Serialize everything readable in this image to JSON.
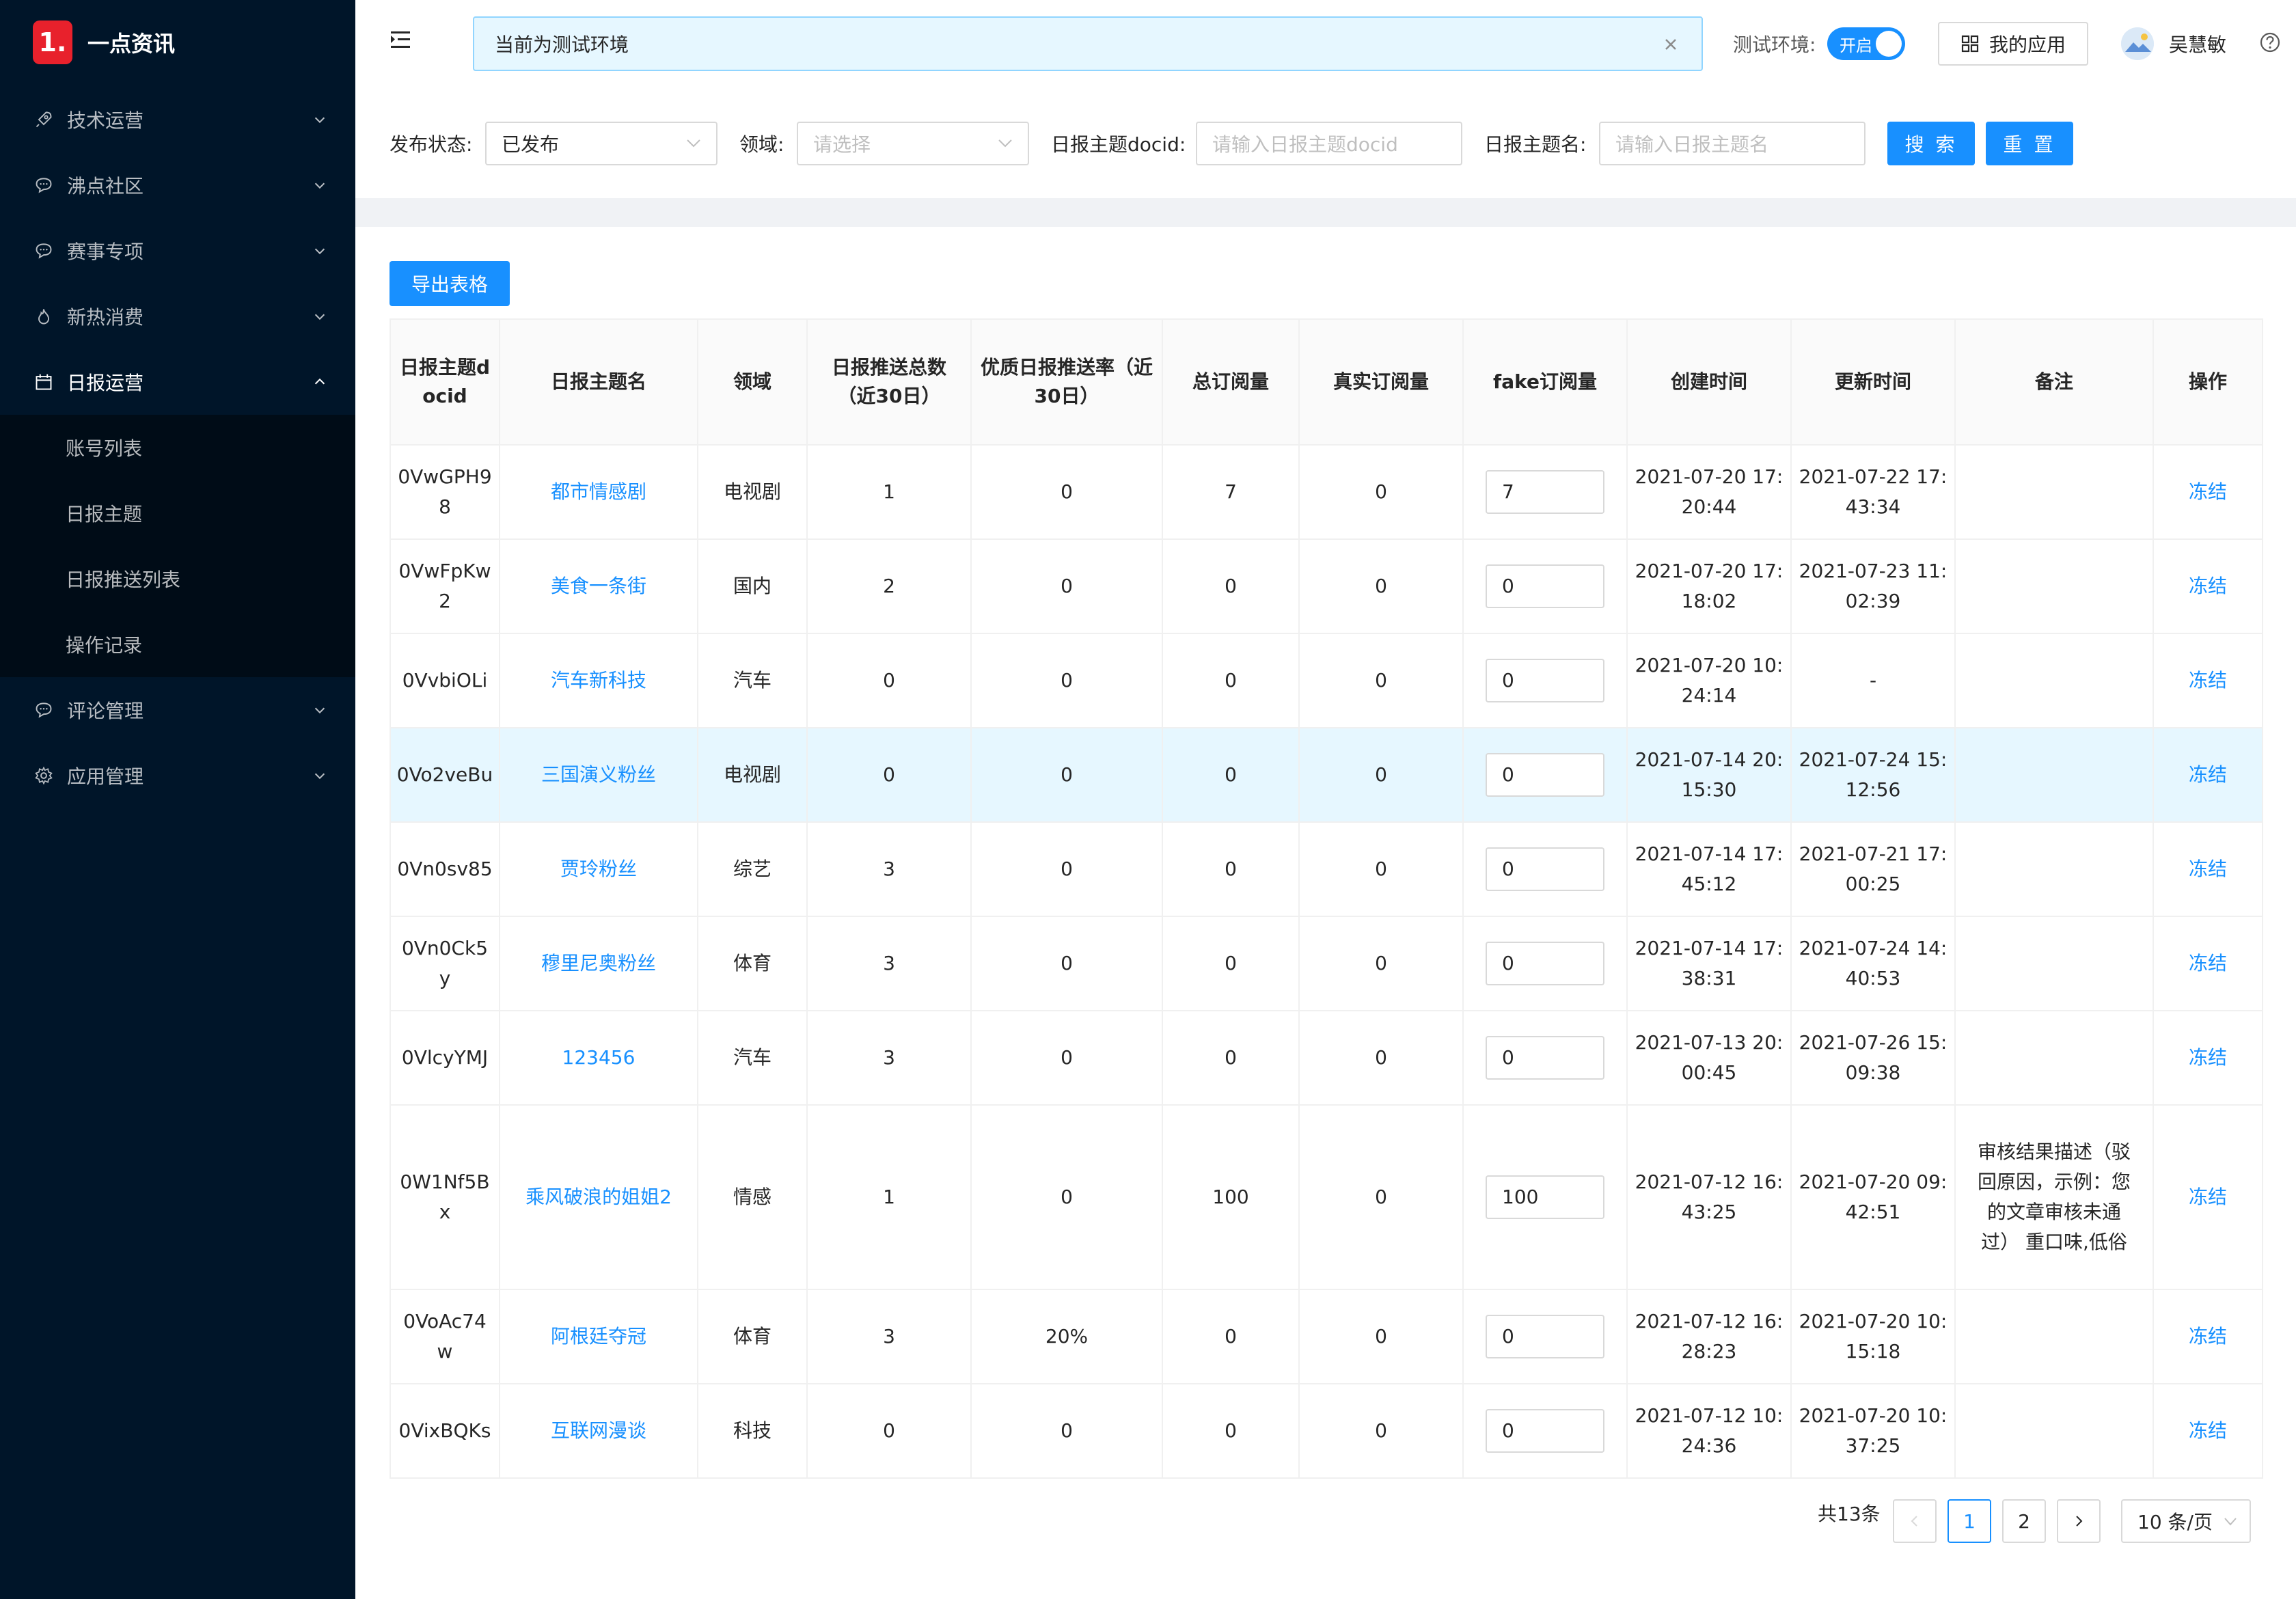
{
  "app": {
    "logo_mark": "1.",
    "title": "一点资讯"
  },
  "sidebar": {
    "items": [
      {
        "label": "技术运营",
        "icon": "rocket-icon"
      },
      {
        "label": "沸点社区",
        "icon": "comment-icon"
      },
      {
        "label": "赛事专项",
        "icon": "comment-icon"
      },
      {
        "label": "新热消费",
        "icon": "fire-icon"
      },
      {
        "label": "日报运营",
        "icon": "calendar-icon",
        "open": true,
        "children": [
          {
            "label": "账号列表"
          },
          {
            "label": "日报主题"
          },
          {
            "label": "日报推送列表"
          },
          {
            "label": "操作记录"
          }
        ]
      },
      {
        "label": "评论管理",
        "icon": "comment-icon"
      },
      {
        "label": "应用管理",
        "icon": "gear-icon"
      }
    ]
  },
  "header": {
    "alert_text": "当前为测试环境",
    "env_label": "测试环境:",
    "env_switch_text": "开启",
    "myapp_label": "我的应用",
    "username": "吴慧敏"
  },
  "filters": {
    "status_label": "发布状态:",
    "status_value": "已发布",
    "domain_label": "领域:",
    "domain_placeholder": "请选择",
    "docid_label": "日报主题docid:",
    "docid_placeholder": "请输入日报主题docid",
    "name_label": "日报主题名:",
    "name_placeholder": "请输入日报主题名",
    "search_btn": "搜 索",
    "reset_btn": "重 置"
  },
  "toolbar": {
    "export_btn": "导出表格"
  },
  "table": {
    "headers": [
      "日报主题docid",
      "日报主题名",
      "领域",
      "日报推送总数（近30日）",
      "优质日报推送率（近30日）",
      "总订阅量",
      "真实订阅量",
      "fake订阅量",
      "创建时间",
      "更新时间",
      "备注",
      "操作"
    ],
    "rows": [
      {
        "docid": "0VwGPH98",
        "name": "都市情感剧",
        "domain": "电视剧",
        "push_total": "1",
        "quality_rate": "0",
        "total_sub": "7",
        "real_sub": "0",
        "fake_sub": "7",
        "created": "2021-07-20 17:20:44",
        "updated": "2021-07-22 17:43:34",
        "note": "",
        "action": "冻结"
      },
      {
        "docid": "0VwFpKw2",
        "name": "美食一条街",
        "domain": "国内",
        "push_total": "2",
        "quality_rate": "0",
        "total_sub": "0",
        "real_sub": "0",
        "fake_sub": "0",
        "created": "2021-07-20 17:18:02",
        "updated": "2021-07-23 11:02:39",
        "note": "",
        "action": "冻结"
      },
      {
        "docid": "0VvbiOLi",
        "name": "汽车新科技",
        "domain": "汽车",
        "push_total": "0",
        "quality_rate": "0",
        "total_sub": "0",
        "real_sub": "0",
        "fake_sub": "0",
        "created": "2021-07-20 10:24:14",
        "updated": "-",
        "note": "",
        "action": "冻结"
      },
      {
        "docid": "0Vo2veBu",
        "name": "三国演义粉丝",
        "domain": "电视剧",
        "push_total": "0",
        "quality_rate": "0",
        "total_sub": "0",
        "real_sub": "0",
        "fake_sub": "0",
        "created": "2021-07-14 20:15:30",
        "updated": "2021-07-24 15:12:56",
        "note": "",
        "action": "冻结",
        "highlight": true
      },
      {
        "docid": "0Vn0sv85",
        "name": "贾玲粉丝",
        "domain": "综艺",
        "push_total": "3",
        "quality_rate": "0",
        "total_sub": "0",
        "real_sub": "0",
        "fake_sub": "0",
        "created": "2021-07-14 17:45:12",
        "updated": "2021-07-21 17:00:25",
        "note": "",
        "action": "冻结"
      },
      {
        "docid": "0Vn0Ck5y",
        "name": "穆里尼奥粉丝",
        "domain": "体育",
        "push_total": "3",
        "quality_rate": "0",
        "total_sub": "0",
        "real_sub": "0",
        "fake_sub": "0",
        "created": "2021-07-14 17:38:31",
        "updated": "2021-07-24 14:40:53",
        "note": "",
        "action": "冻结"
      },
      {
        "docid": "0VlcyYMJ",
        "name": "123456",
        "domain": "汽车",
        "push_total": "3",
        "quality_rate": "0",
        "total_sub": "0",
        "real_sub": "0",
        "fake_sub": "0",
        "created": "2021-07-13 20:00:45",
        "updated": "2021-07-26 15:09:38",
        "note": "",
        "action": "冻结"
      },
      {
        "docid": "0W1Nf5Bx",
        "name": "乘风破浪的姐姐2",
        "domain": "情感",
        "push_total": "1",
        "quality_rate": "0",
        "total_sub": "100",
        "real_sub": "0",
        "fake_sub": "100",
        "created": "2021-07-12 16:43:25",
        "updated": "2021-07-20 09:42:51",
        "note": "审核结果描述（驳回原因，示例：您的文章审核未通过） 重口味,低俗",
        "action": "冻结",
        "tall": true
      },
      {
        "docid": "0VoAc74w",
        "name": "阿根廷夺冠",
        "domain": "体育",
        "push_total": "3",
        "quality_rate": "20%",
        "total_sub": "0",
        "real_sub": "0",
        "fake_sub": "0",
        "created": "2021-07-12 16:28:23",
        "updated": "2021-07-20 10:15:18",
        "note": "",
        "action": "冻结"
      },
      {
        "docid": "0VixBQKs",
        "name": "互联网漫谈",
        "domain": "科技",
        "push_total": "0",
        "quality_rate": "0",
        "total_sub": "0",
        "real_sub": "0",
        "fake_sub": "0",
        "created": "2021-07-12 10:24:36",
        "updated": "2021-07-20 10:37:25",
        "note": "",
        "action": "冻结"
      }
    ]
  },
  "pagination": {
    "total_text": "共13条",
    "pages": [
      "1",
      "2"
    ],
    "current": "1",
    "page_size": "10 条/页"
  },
  "colors": {
    "primary": "#1890ff",
    "sidebar_bg": "#001529",
    "logo_red": "#e8212c"
  }
}
